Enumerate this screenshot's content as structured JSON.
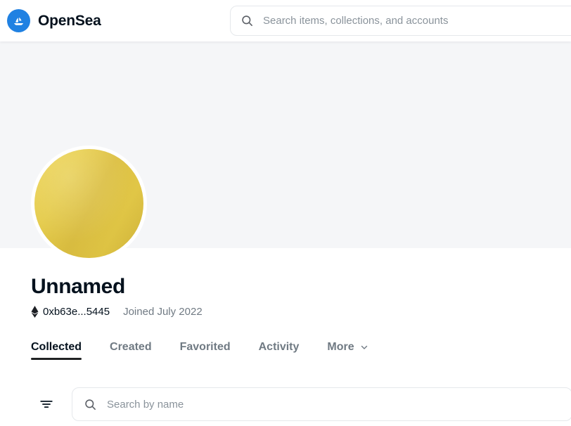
{
  "header": {
    "brand_name": "OpenSea",
    "logo_icon": "opensea-sailboat-icon",
    "brand_color": "#2081e2",
    "search": {
      "icon": "search-icon",
      "placeholder": "Search items, collections, and accounts",
      "value": ""
    }
  },
  "banner": {
    "background_color": "#f5f6f8"
  },
  "profile": {
    "avatar_icon": "default-avatar",
    "avatar_color": "#e9ce46",
    "display_name": "Unnamed",
    "address_icon": "ethereum-icon",
    "address": "0xb63e...5445",
    "joined": "Joined July 2022"
  },
  "tabs": [
    {
      "label": "Collected",
      "active": true,
      "icon": null
    },
    {
      "label": "Created",
      "active": false,
      "icon": null
    },
    {
      "label": "Favorited",
      "active": false,
      "icon": null
    },
    {
      "label": "Activity",
      "active": false,
      "icon": null
    },
    {
      "label": "More",
      "active": false,
      "icon": "chevron-down-icon"
    }
  ],
  "filter_bar": {
    "filter_icon": "filter-icon",
    "search": {
      "icon": "search-icon",
      "placeholder": "Search by name",
      "value": ""
    }
  }
}
